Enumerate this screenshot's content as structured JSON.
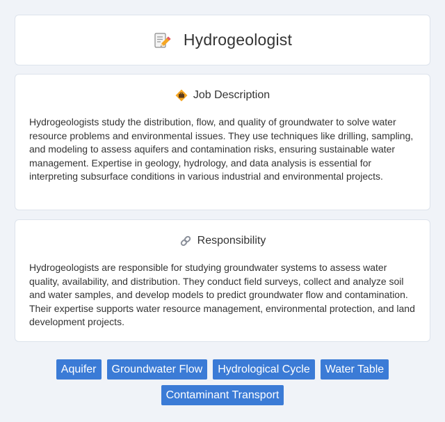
{
  "header": {
    "title": "Hydrogeologist",
    "icon": "memo-pencil-icon"
  },
  "sections": [
    {
      "title": "Job Description",
      "icon": "diamond-briefcase-icon",
      "text": "Hydrogeologists study the distribution, flow, and quality of groundwater to solve water resource problems and environmental issues. They use techniques like drilling, sampling, and modeling to assess aquifers and contamination risks, ensuring sustainable water management. Expertise in geology, hydrology, and data analysis is essential for interpreting subsurface conditions in various industrial and environmental projects."
    },
    {
      "title": "Responsibility",
      "icon": "link-icon",
      "text": "Hydrogeologists are responsible for studying groundwater systems to assess water quality, availability, and distribution. They conduct field surveys, collect and analyze soil and water samples, and develop models to predict groundwater flow and contamination. Their expertise supports water resource management, environmental protection, and land development projects."
    }
  ],
  "tags": [
    "Aquifer",
    "Groundwater Flow",
    "Hydrological Cycle",
    "Water Table",
    "Contaminant Transport"
  ],
  "colors": {
    "background": "#f0f3f8",
    "card": "#ffffff",
    "tag": "#3b7bd6"
  }
}
